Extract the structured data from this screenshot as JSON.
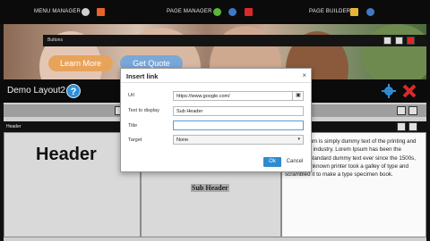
{
  "toolbar": {
    "menu_manager": "MENU MANAGER",
    "page_manager": "PAGE MANAGER",
    "page_builder": "PAGE BUILDER"
  },
  "hero": {
    "buttons_label": "Buttons",
    "learn_more": "Learn More",
    "get_quote": "Get Quote"
  },
  "layout": {
    "title": "Demo Layout2",
    "help_glyph": "?",
    "row_label": "Header"
  },
  "content": {
    "header_text": "Header",
    "subheader_text": "Sub Header",
    "lorem": "Lorem Ipsum is simply dummy text of the printing and typesetting industry. Lorem Ipsum has been the industry's standard dummy text ever since the 1500s, when an unknown printer took a galley of type and scrambled it to make a type specimen book."
  },
  "dialog": {
    "title": "Insert link",
    "close": "×",
    "url_label": "Url",
    "url_value": "https://www.google.com/",
    "text_label": "Text to display",
    "text_value": "Sub Header",
    "title_label": "Title",
    "title_value": "",
    "target_label": "Target",
    "target_value": "None",
    "ok": "Ok",
    "cancel": "Cancel"
  },
  "colors": {
    "accent_blue": "#2d8bd1",
    "learn_more_orange": "#e8a35a",
    "get_quote_blue": "#79a7d8"
  }
}
